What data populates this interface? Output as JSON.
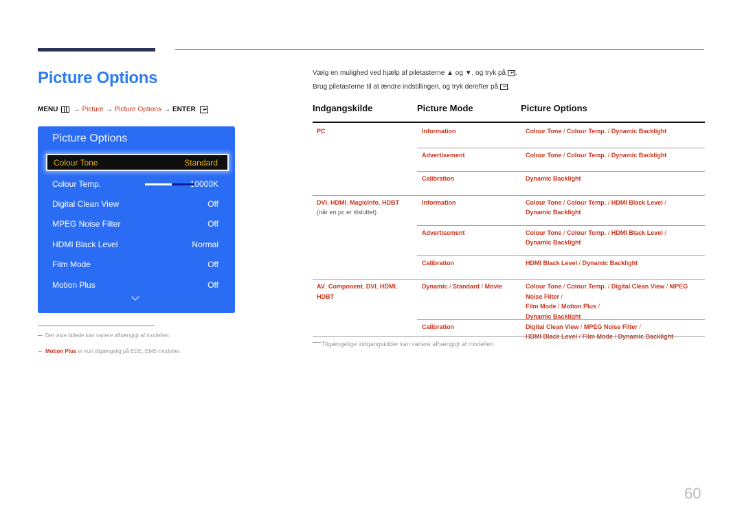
{
  "page": {
    "title": "Picture Options",
    "number": "60"
  },
  "menu_path": {
    "menu": "MENU",
    "menu_icon": "menu-grid-icon",
    "arrow": "→",
    "picture": "Picture",
    "picture_options": "Picture Options",
    "enter": "ENTER",
    "enter_icon": "enter-icon"
  },
  "osd": {
    "title": "Picture Options",
    "items": [
      {
        "label": "Colour Tone",
        "value": "Standard",
        "selected": true
      },
      {
        "label": "Colour Temp.",
        "value": "10000K",
        "slider_fraction": 0.54
      },
      {
        "label": "Digital Clean View",
        "value": "Off"
      },
      {
        "label": "MPEG Noise Filter",
        "value": "Off"
      },
      {
        "label": "HDMI Black Level",
        "value": "Normal"
      },
      {
        "label": "Film Mode",
        "value": "Off"
      },
      {
        "label": "Motion Plus",
        "value": "Off"
      }
    ],
    "more_icon": "chevron-down-icon"
  },
  "notes": [
    {
      "text": "Det viste billede kan variere afhængigt af modellen."
    },
    {
      "highlight": "Motion Plus",
      "text": " er kun tilgængelig på EDE, EME-modeller."
    }
  ],
  "instructions": {
    "line1_a": "Vælg en mulighed ved hjælp af piletasterne ",
    "up_icon": "▲",
    "line1_b": " og ",
    "down_icon": "▼",
    "line1_c": ", og tryk på ",
    "line1_end": ".",
    "line2": "Brug piletasterne til at ændre indstillingen, og tryk derefter på ",
    "line2_end": "."
  },
  "table": {
    "headers": [
      "Indgangskilde",
      "Picture Mode",
      "Picture Options"
    ],
    "groups": [
      {
        "source": [
          "PC"
        ],
        "source_note": "",
        "rows": [
          {
            "mode": [
              "Information"
            ],
            "options": [
              "Colour Tone",
              "Colour Temp.",
              "Dynamic Backlight"
            ]
          },
          {
            "mode": [
              "Advertisement"
            ],
            "options": [
              "Colour Tone",
              "Colour Temp.",
              "Dynamic Backlight"
            ]
          },
          {
            "mode": [
              "Calibration"
            ],
            "options": [
              "Dynamic Backlight"
            ]
          }
        ]
      },
      {
        "source": [
          "DVI",
          "HDMI",
          "MagicInfo",
          "HDBT"
        ],
        "source_note": "(når en pc er tilsluttet)",
        "rows": [
          {
            "mode": [
              "Information"
            ],
            "options": [
              "Colour Tone",
              "Colour Temp.",
              "HDMI Black Level",
              "Dynamic Backlight"
            ]
          },
          {
            "mode": [
              "Advertisement"
            ],
            "options": [
              "Colour Tone",
              "Colour Temp.",
              "HDMI Black Level",
              "Dynamic Backlight"
            ]
          },
          {
            "mode": [
              "Calibration"
            ],
            "options": [
              "HDMI Black Level",
              "Dynamic Backlight"
            ]
          }
        ]
      },
      {
        "source": [
          "AV",
          "Component",
          "DVI",
          "HDMI",
          "HDBT"
        ],
        "source_note": "",
        "rows": [
          {
            "mode": [
              "Dynamic",
              "Standard",
              "Movie"
            ],
            "options": [
              "Colour Tone",
              "Colour Temp.",
              "Digital Clean View",
              "MPEG Noise Filter",
              "Film Mode",
              "Motion Plus",
              "Dynamic Backlight"
            ]
          },
          {
            "mode": [
              "Calibration"
            ],
            "options": [
              "Digital Clean View",
              "MPEG Noise Filter",
              "HDMI Black Level",
              "Film Mode",
              "Dynamic Backlight"
            ]
          }
        ]
      }
    ],
    "footnote": "Tilgængelige indgangskilder kan variere afhængigt af modellen."
  }
}
